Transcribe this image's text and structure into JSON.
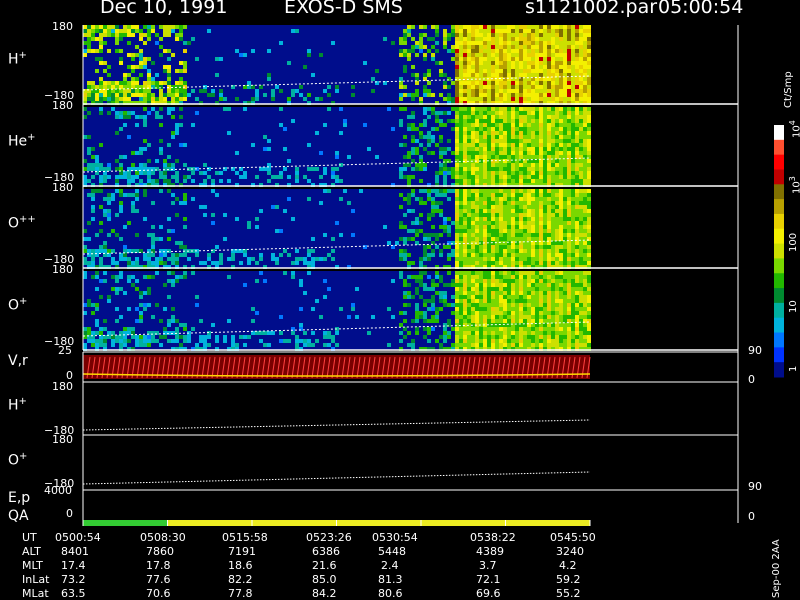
{
  "header": {
    "date": "Dec 10, 1991",
    "mission": "EXOS-D SMS",
    "file": "s1121002.par",
    "time": "05:00:54"
  },
  "panels": [
    {
      "label_base": "H",
      "label_sup": "+",
      "top_tick": "180",
      "bottom_tick": "−180"
    },
    {
      "label_base": "He",
      "label_sup": "+",
      "top_tick": "180",
      "bottom_tick": "−180"
    },
    {
      "label_base": "O",
      "label_sup": "++",
      "top_tick": "180",
      "bottom_tick": "−180"
    },
    {
      "label_base": "O",
      "label_sup": "+",
      "top_tick": "180",
      "bottom_tick": "−180"
    }
  ],
  "vr_panel": {
    "label": "V,r",
    "left_top": "25",
    "left_bottom": "0",
    "right_top": "90",
    "right_bottom": "0"
  },
  "h_line_panel": {
    "label_base": "H",
    "label_sup": "+",
    "top_tick": "180",
    "bottom_tick": "−180"
  },
  "o_line_panel": {
    "label_base": "O",
    "label_sup": "+",
    "top_tick": "180",
    "bottom_tick": "−180"
  },
  "ep_panel": {
    "label": "E,p",
    "qa_label": "QA",
    "left_top": "4000",
    "left_bottom": "0",
    "right_top": "90",
    "right_bottom": "0"
  },
  "colorbar": {
    "units": "Ct/Smp",
    "ticks": [
      "1",
      "10",
      "100",
      "10",
      "10",
      "10"
    ],
    "tick_sups": [
      "",
      "",
      "",
      "3",
      "4",
      ""
    ],
    "colors": [
      "#000d8c",
      "#0033ff",
      "#0077ff",
      "#00b3dd",
      "#00b0a0",
      "#008a30",
      "#22b800",
      "#7ad800",
      "#cce000",
      "#f4f000",
      "#e8d000",
      "#b8a000",
      "#807000",
      "#c00000",
      "#ff0000",
      "#ff5030",
      "#ffffff"
    ]
  },
  "footer_label": "Sep-00  2AA",
  "chart_data": {
    "type": "heatmap",
    "title": "Dec 10, 1991   EXOS-D SMS",
    "time_axis": [
      "0500:54",
      "0508:30",
      "0515:58",
      "0523:26",
      "0530:54",
      "0538:22",
      "0545:50"
    ],
    "data_end_time": "0545:50",
    "panels": [
      {
        "name": "H+",
        "ylim": [
          -180,
          180
        ],
        "colorscale": "log",
        "zlim": [
          1,
          10000
        ]
      },
      {
        "name": "He+",
        "ylim": [
          -180,
          180
        ],
        "colorscale": "log",
        "zlim": [
          1,
          10000
        ]
      },
      {
        "name": "O++",
        "ylim": [
          -180,
          180
        ],
        "colorscale": "log",
        "zlim": [
          1,
          10000
        ]
      },
      {
        "name": "O+",
        "ylim": [
          -180,
          180
        ],
        "colorscale": "log",
        "zlim": [
          1,
          10000
        ]
      },
      {
        "name": "V,r",
        "ylim_left": [
          0,
          25
        ],
        "ylim_right": [
          0,
          90
        ]
      },
      {
        "name": "H+",
        "ylim": [
          -180,
          180
        ]
      },
      {
        "name": "O+",
        "ylim": [
          -180,
          180
        ]
      },
      {
        "name": "E,p",
        "ylim_left": [
          0,
          4000
        ],
        "ylim_right": [
          0,
          90
        ]
      }
    ],
    "qa_bar": [
      {
        "from": "0500:54",
        "to": "0508:30",
        "color": "#33cc33"
      },
      {
        "from": "0508:30",
        "to": "0545:50",
        "color": "#ecec22"
      }
    ],
    "table": {
      "rows": [
        {
          "name": "UT",
          "values": [
            "0500:54",
            "0508:30",
            "0515:58",
            "0523:26",
            "0530:54",
            "0538:22",
            "0545:50"
          ]
        },
        {
          "name": "ALT",
          "values": [
            "8401",
            "7860",
            "7191",
            "6386",
            "5448",
            "4389",
            "3240"
          ]
        },
        {
          "name": "MLT",
          "values": [
            "17.4",
            "17.8",
            "18.6",
            "21.6",
            "2.4",
            "3.7",
            "4.2"
          ]
        },
        {
          "name": "InLat",
          "values": [
            "73.2",
            "77.6",
            "82.2",
            "85.0",
            "81.3",
            "72.1",
            "59.2"
          ]
        },
        {
          "name": "MLat",
          "values": [
            "63.5",
            "70.6",
            "77.8",
            "84.2",
            "80.6",
            "69.6",
            "55.2"
          ]
        }
      ]
    }
  }
}
